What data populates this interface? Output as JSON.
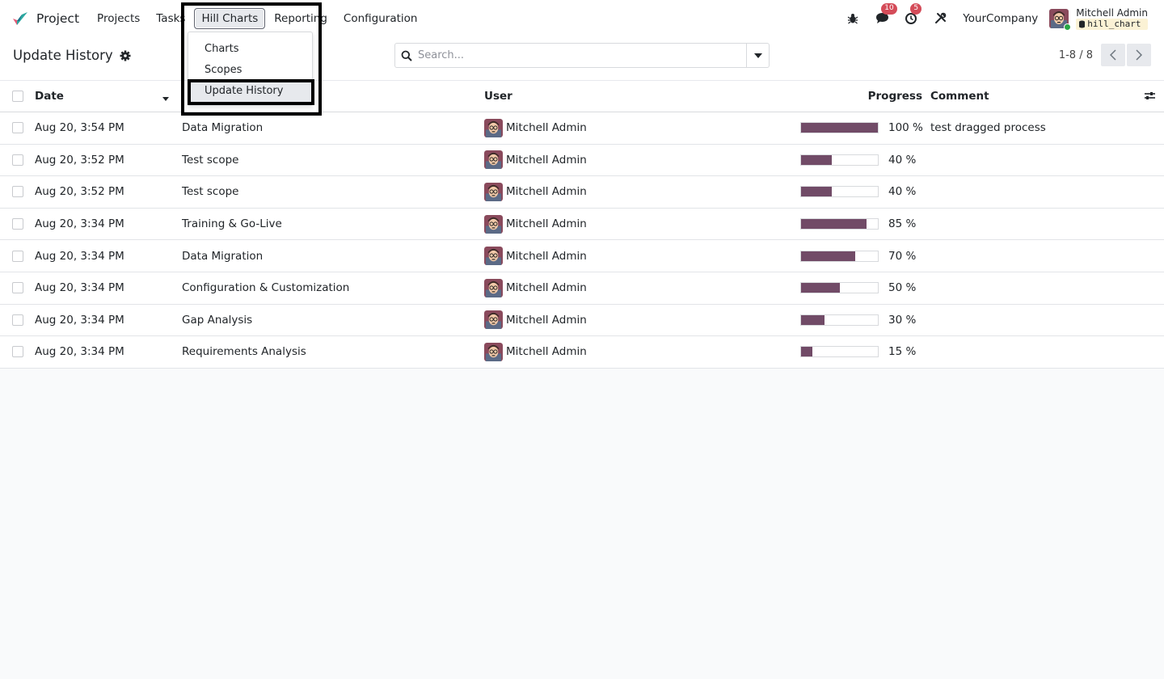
{
  "app": {
    "name": "Project"
  },
  "menu": {
    "items": [
      "Projects",
      "Tasks",
      "Hill Charts",
      "Reporting",
      "Configuration"
    ],
    "open_index": 2,
    "dropdown": [
      "Charts",
      "Scopes",
      "Update History"
    ],
    "dropdown_active": "Update History"
  },
  "systray": {
    "messages_count": "10",
    "activities_count": "5",
    "company": "YourCompany",
    "user_name": "Mitchell Admin",
    "database": "hill_chart"
  },
  "colors": {
    "accent": "#714b67",
    "badge": "#d44c59",
    "online": "#28a745"
  },
  "page": {
    "title": "Update History"
  },
  "search": {
    "placeholder": "Search..."
  },
  "pager": {
    "value": "1-8 / 8"
  },
  "table": {
    "columns": {
      "date": "Date",
      "user": "User",
      "progress": "Progress",
      "comment": "Comment"
    },
    "rows": [
      {
        "date": "Aug 20, 3:54 PM",
        "scope": "Data Migration",
        "user": "Mitchell Admin",
        "progress": 100,
        "progress_label": "100 %",
        "comment": "test dragged process"
      },
      {
        "date": "Aug 20, 3:52 PM",
        "scope": "Test scope",
        "user": "Mitchell Admin",
        "progress": 40,
        "progress_label": "40 %",
        "comment": ""
      },
      {
        "date": "Aug 20, 3:52 PM",
        "scope": "Test scope",
        "user": "Mitchell Admin",
        "progress": 40,
        "progress_label": "40 %",
        "comment": ""
      },
      {
        "date": "Aug 20, 3:34 PM",
        "scope": "Training & Go-Live",
        "user": "Mitchell Admin",
        "progress": 85,
        "progress_label": "85 %",
        "comment": ""
      },
      {
        "date": "Aug 20, 3:34 PM",
        "scope": "Data Migration",
        "user": "Mitchell Admin",
        "progress": 70,
        "progress_label": "70 %",
        "comment": ""
      },
      {
        "date": "Aug 20, 3:34 PM",
        "scope": "Configuration & Customization",
        "user": "Mitchell Admin",
        "progress": 50,
        "progress_label": "50 %",
        "comment": ""
      },
      {
        "date": "Aug 20, 3:34 PM",
        "scope": "Gap Analysis",
        "user": "Mitchell Admin",
        "progress": 30,
        "progress_label": "30 %",
        "comment": ""
      },
      {
        "date": "Aug 20, 3:34 PM",
        "scope": "Requirements Analysis",
        "user": "Mitchell Admin",
        "progress": 15,
        "progress_label": "15 %",
        "comment": ""
      }
    ]
  }
}
